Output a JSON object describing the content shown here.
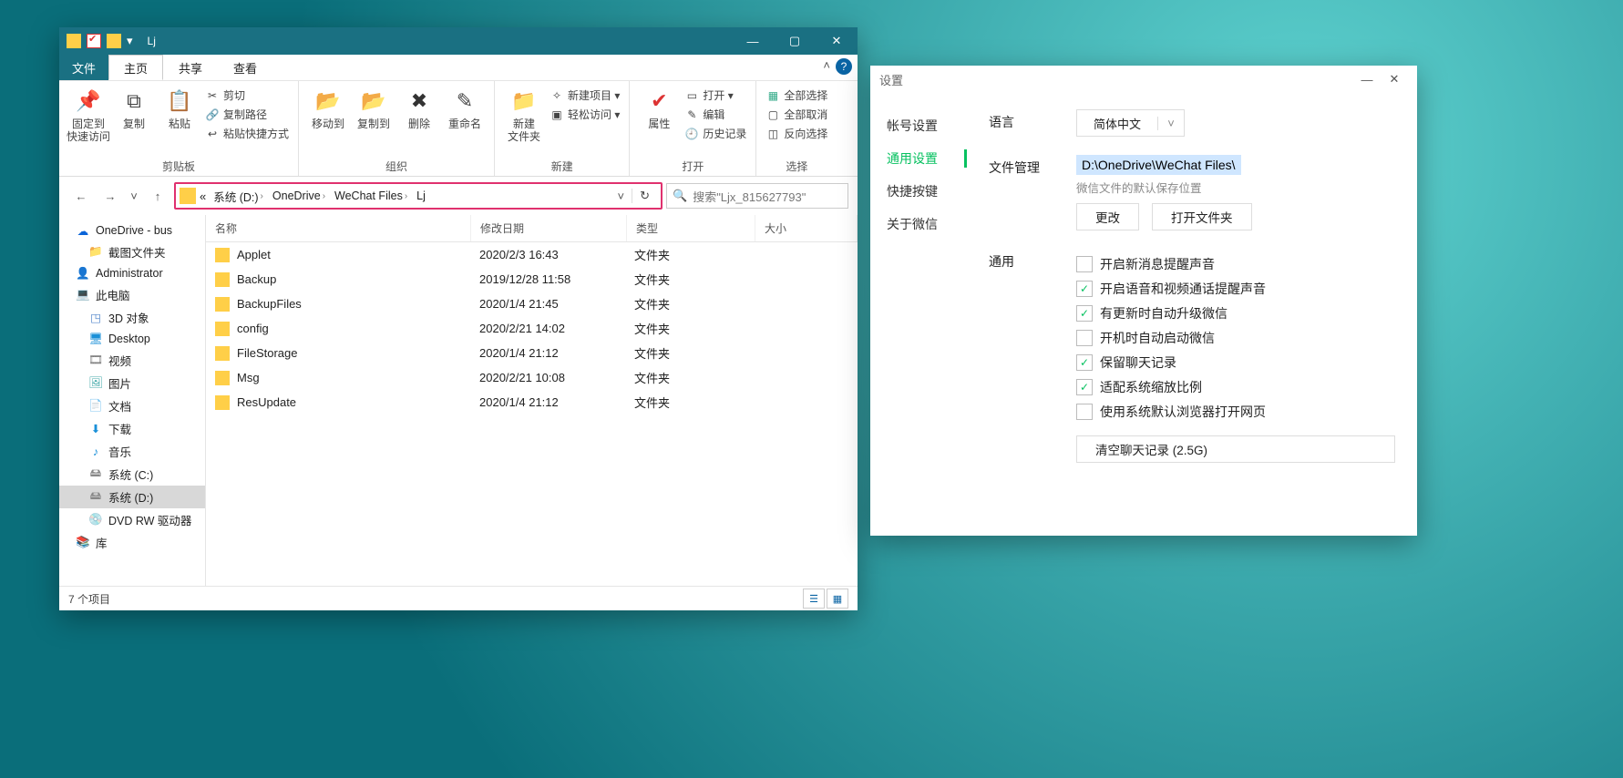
{
  "explorer": {
    "title": "Lj",
    "menu": {
      "file": "文件",
      "tabs": [
        "主页",
        "共享",
        "查看"
      ]
    },
    "ribbon": {
      "clipboard": {
        "label": "剪贴板",
        "pin": "固定到\n快速访问",
        "copy": "复制",
        "paste": "粘贴",
        "cut": "剪切",
        "copypath": "复制路径",
        "pshortcut": "粘贴快捷方式"
      },
      "organize": {
        "label": "组织",
        "moveto": "移动到",
        "copyto": "复制到",
        "delete": "删除",
        "rename": "重命名"
      },
      "new": {
        "label": "新建",
        "newfolder": "新建\n文件夹",
        "newitem": "新建项目 ▾",
        "easyaccess": "轻松访问 ▾"
      },
      "open": {
        "label": "打开",
        "props": "属性",
        "open": "打开 ▾",
        "edit": "编辑",
        "history": "历史记录"
      },
      "select": {
        "label": "选择",
        "all": "全部选择",
        "none": "全部取消",
        "invert": "反向选择"
      }
    },
    "path": {
      "crumbs": [
        "系统 (D:)",
        "OneDrive",
        "WeChat Files",
        "Lj"
      ],
      "prefix": "«"
    },
    "search": {
      "placeholder": "搜索\"Ljx_815627793\""
    },
    "columns": {
      "name": "名称",
      "date": "修改日期",
      "type": "类型",
      "size": "大小"
    },
    "rows": [
      {
        "name": "Applet",
        "date": "2020/2/3 16:43",
        "type": "文件夹"
      },
      {
        "name": "Backup",
        "date": "2019/12/28 11:58",
        "type": "文件夹"
      },
      {
        "name": "BackupFiles",
        "date": "2020/1/4 21:45",
        "type": "文件夹"
      },
      {
        "name": "config",
        "date": "2020/2/21 14:02",
        "type": "文件夹"
      },
      {
        "name": "FileStorage",
        "date": "2020/1/4 21:12",
        "type": "文件夹"
      },
      {
        "name": "Msg",
        "date": "2020/2/21 10:08",
        "type": "文件夹"
      },
      {
        "name": "ResUpdate",
        "date": "2020/1/4 21:12",
        "type": "文件夹"
      }
    ],
    "tree": [
      {
        "icon": "☁",
        "label": "OneDrive - bus",
        "color": "#0a64d8"
      },
      {
        "icon": "📁",
        "label": "截图文件夹",
        "color": "#ffcf48",
        "indent": 1
      },
      {
        "icon": "👤",
        "label": "Administrator",
        "color": "#5a8"
      },
      {
        "icon": "💻",
        "label": "此电脑",
        "color": "#4aa"
      },
      {
        "icon": "◳",
        "label": "3D 对象",
        "color": "#58c",
        "indent": 1
      },
      {
        "icon": "🖥",
        "label": "Desktop",
        "color": "#1a90d8",
        "indent": 1
      },
      {
        "icon": "🎞",
        "label": "视频",
        "color": "#777",
        "indent": 1
      },
      {
        "icon": "🖼",
        "label": "图片",
        "color": "#4aa",
        "indent": 1
      },
      {
        "icon": "📄",
        "label": "文档",
        "color": "#4aa",
        "indent": 1
      },
      {
        "icon": "⬇",
        "label": "下载",
        "color": "#1a90d8",
        "indent": 1
      },
      {
        "icon": "♪",
        "label": "音乐",
        "color": "#1a90d8",
        "indent": 1
      },
      {
        "icon": "🖴",
        "label": "系统 (C:)",
        "color": "#888",
        "indent": 1
      },
      {
        "icon": "🖴",
        "label": "系统 (D:)",
        "color": "#888",
        "indent": 1,
        "sel": true
      },
      {
        "icon": "💿",
        "label": "DVD RW 驱动器",
        "color": "#888",
        "indent": 1
      },
      {
        "icon": "📚",
        "label": "库",
        "color": "#d9a33c"
      }
    ],
    "status": "7 个项目"
  },
  "settings": {
    "title": "设置",
    "nav": [
      "帐号设置",
      "通用设置",
      "快捷按键",
      "关于微信"
    ],
    "nav_active": 1,
    "lang": {
      "label": "语言",
      "value": "简体中文"
    },
    "file": {
      "label": "文件管理",
      "path": "D:\\OneDrive\\WeChat Files\\",
      "hint": "微信文件的默认保存位置",
      "change": "更改",
      "open": "打开文件夹"
    },
    "general": {
      "label": "通用",
      "opts": [
        {
          "label": "开启新消息提醒声音",
          "checked": false
        },
        {
          "label": "开启语音和视频通话提醒声音",
          "checked": true
        },
        {
          "label": "有更新时自动升级微信",
          "checked": true
        },
        {
          "label": "开机时自动启动微信",
          "checked": false
        },
        {
          "label": "保留聊天记录",
          "checked": true
        },
        {
          "label": "适配系统缩放比例",
          "checked": true
        },
        {
          "label": "使用系统默认浏览器打开网页",
          "checked": false
        }
      ],
      "clear": "清空聊天记录 (2.5G)"
    }
  }
}
